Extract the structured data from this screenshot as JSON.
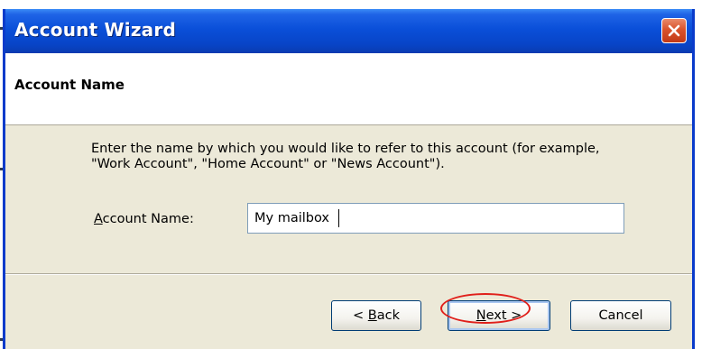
{
  "window": {
    "title": "Account Wizard"
  },
  "header": {
    "title": "Account Name"
  },
  "body": {
    "instructions": "Enter the name by which you would like to refer to this account (for example, \"Work Account\", \"Home Account\" or \"News Account\").",
    "field_label_accel": "A",
    "field_label_rest": "ccount Name:",
    "field_value": "My mailbox"
  },
  "buttons": {
    "back_prefix": "< ",
    "back_accel": "B",
    "back_rest": "ack",
    "next_accel": "N",
    "next_rest": "ext >",
    "cancel": "Cancel"
  },
  "colors": {
    "titlebar": "#0a4fd9",
    "dialog_bg": "#ece9d8",
    "highlight": "#e0201b",
    "close_button": "#d9532c"
  },
  "icons": {
    "close": "close-icon"
  }
}
